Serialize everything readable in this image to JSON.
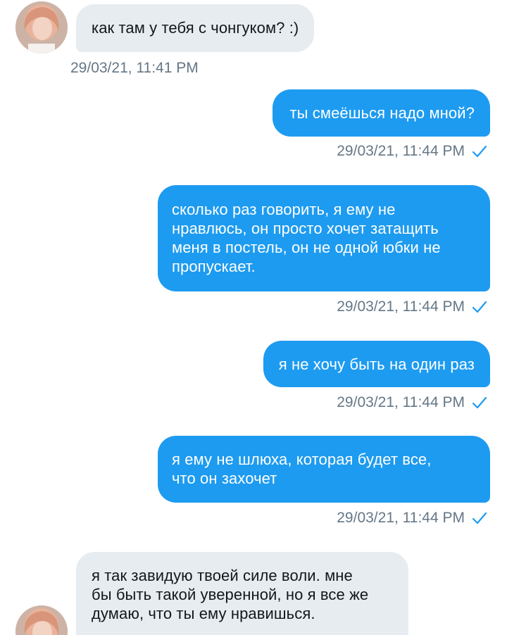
{
  "colors": {
    "outgoing_bubble": "#1d9bf0",
    "incoming_bubble": "#e7ecf0",
    "timestamp": "#657786",
    "read_check": "#1d9bf0"
  },
  "messages": [
    {
      "direction": "incoming",
      "text": "как там у тебя с чонгуком? :)",
      "time": "29/03/21, 11:41 PM"
    },
    {
      "direction": "outgoing",
      "text": "ты смеёшься надо мной?",
      "time": "29/03/21, 11:44 PM",
      "status_icon": "check-icon"
    },
    {
      "direction": "outgoing",
      "text": "сколько раз говорить, я ему не\nнравлюсь, он просто хочет затащить\nменя в постель, он не одной юбки не\nпропускает.",
      "time": "29/03/21, 11:44 PM",
      "status_icon": "check-icon"
    },
    {
      "direction": "outgoing",
      "text": "я не хочу быть на один раз",
      "time": "29/03/21, 11:44 PM",
      "status_icon": "check-icon"
    },
    {
      "direction": "outgoing",
      "text": "я ему не шлюха, которая будет все,\nчто он захочет",
      "time": "29/03/21, 11:44 PM",
      "status_icon": "check-icon"
    },
    {
      "direction": "incoming",
      "text": "я так завидую твоей силе воли. мне\nбы быть такой уверенной, но я все же\nдумаю, что ты ему нравишься.",
      "time": ""
    }
  ]
}
